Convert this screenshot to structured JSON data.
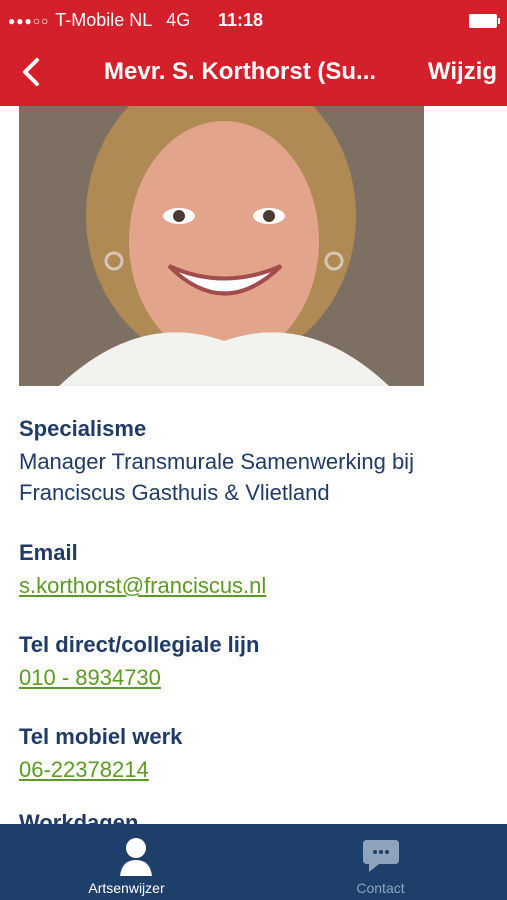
{
  "status_bar": {
    "carrier": "T-Mobile NL",
    "network": "4G",
    "time": "11:18"
  },
  "nav": {
    "back_icon": "chevron-left-icon",
    "title": "Mevr. S. Korthorst (Su...",
    "action": "Wijzig"
  },
  "profile": {
    "fields": {
      "specialism": {
        "label": "Specialisme",
        "value_line1": "Manager Transmurale Samenwerking bij",
        "value_line2": "Franciscus Gasthuis & Vlietland"
      },
      "email": {
        "label": "Email",
        "value": "s.korthorst@franciscus.nl"
      },
      "tel_direct": {
        "label": "Tel direct/collegiale lijn",
        "value": "010 - 8934730"
      },
      "tel_mobile": {
        "label": "Tel mobiel werk",
        "value": "06-22378214"
      },
      "workdays": {
        "label": "Workdagen"
      }
    }
  },
  "tabbar": {
    "tabs": [
      {
        "label": "Artsenwijzer",
        "icon": "person-icon",
        "active": true
      },
      {
        "label": "Contact",
        "icon": "chat-bubble-icon",
        "active": false
      }
    ]
  },
  "colors": {
    "brand_red": "#d4202a",
    "navy": "#1f3b66",
    "tab_bg": "#1f3f6b",
    "link_green": "#5b9a24"
  }
}
